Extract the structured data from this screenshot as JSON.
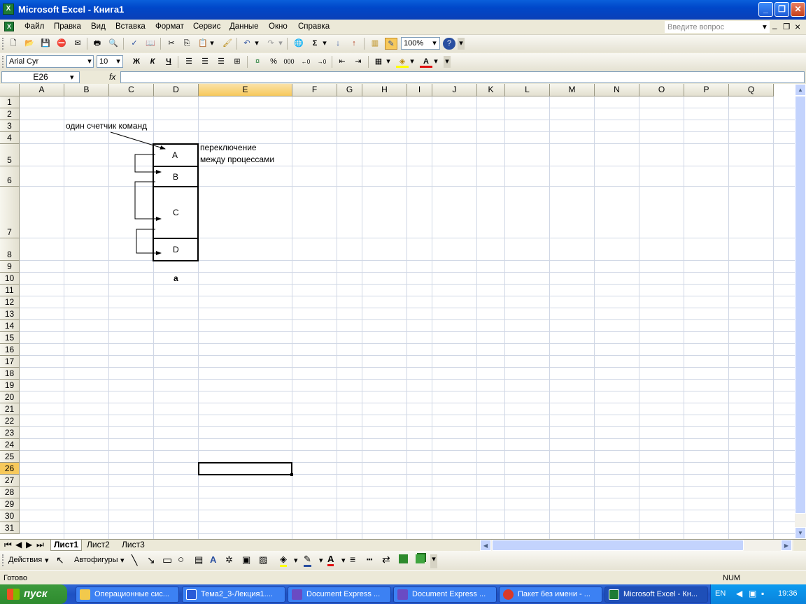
{
  "title": "Microsoft Excel - Книга1",
  "window_buttons": {
    "minimize": "_",
    "restore": "❐",
    "close": "✕"
  },
  "menu": [
    "Файл",
    "Правка",
    "Вид",
    "Вставка",
    "Формат",
    "Сервис",
    "Данные",
    "Окно",
    "Справка"
  ],
  "ask_placeholder": "Введите вопрос",
  "doc_controls": {
    "minimize": "_",
    "restore": "❐",
    "close": "×"
  },
  "toolbar": {
    "zoom": "100%"
  },
  "format": {
    "font": "Arial Cyr",
    "size": "10",
    "bold": "Ж",
    "italic": "К",
    "underline": "Ч",
    "percent": "%",
    "thousands": "000"
  },
  "namebox": "E26",
  "fx": "fx",
  "columns": [
    "A",
    "B",
    "C",
    "D",
    "E",
    "F",
    "G",
    "H",
    "I",
    "J",
    "K",
    "L",
    "M",
    "N",
    "O",
    "P",
    "Q"
  ],
  "rows": [
    "1",
    "2",
    "3",
    "4",
    "5",
    "6",
    "7",
    "8",
    "9",
    "10",
    "11",
    "12",
    "13",
    "14",
    "15",
    "16",
    "17",
    "18",
    "19",
    "20",
    "21",
    "22",
    "23",
    "24",
    "25",
    "26",
    "27",
    "28",
    "29",
    "30",
    "31"
  ],
  "cells": {
    "note1": "один счетчик команд",
    "note2a": "переключение",
    "note2b": "между процессами",
    "boxA": "A",
    "boxB": "B",
    "boxC": "C",
    "boxD": "D",
    "caption": "а"
  },
  "sheets": [
    "Лист1",
    "Лист2",
    "Лист3"
  ],
  "drawing": {
    "actions": "Действия",
    "autoshapes": "Автофигуры"
  },
  "status": {
    "ready": "Готово",
    "num": "NUM"
  },
  "taskbar": {
    "start": "пуск",
    "tasks": [
      "Операционные сис...",
      "Тема2_3-Лекция1....",
      "Document Express ...",
      "Document Express ...",
      "Пакет без имени - ...",
      "Microsoft Excel - Кн..."
    ],
    "lang": "EN",
    "clock": "19:36"
  }
}
